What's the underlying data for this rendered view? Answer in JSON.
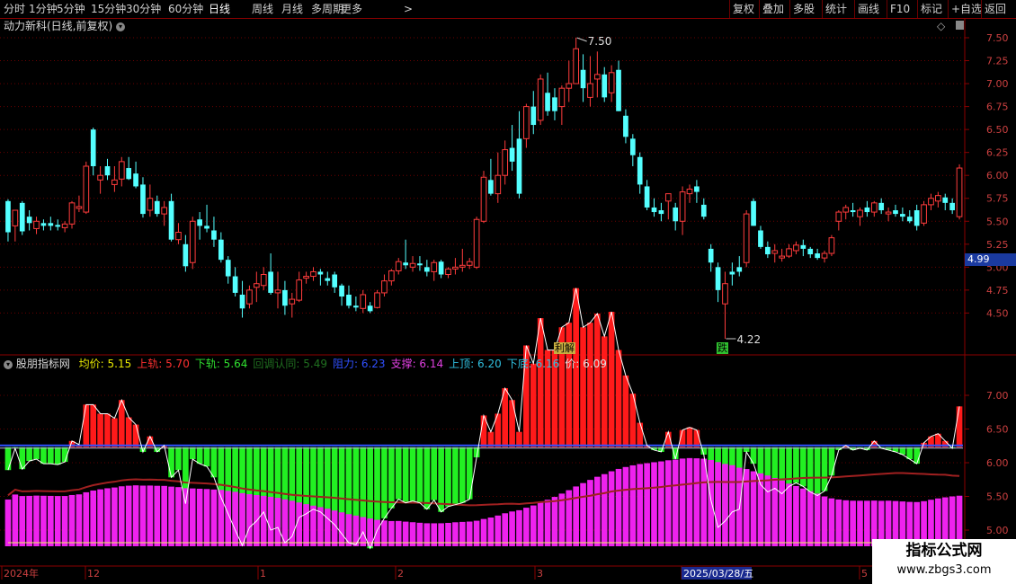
{
  "toolbar": {
    "periods": [
      "分时",
      "1分钟",
      "5分钟",
      "15分钟",
      "30分钟",
      "60分钟",
      "日线",
      "周线",
      "月线",
      "多周期",
      "更多"
    ],
    "active_period": "日线",
    "more_chevron": ">",
    "right_buttons": [
      "复权",
      "叠加",
      "多股",
      "统计",
      "画线",
      "F10",
      "标记",
      "+自选",
      "返回"
    ]
  },
  "main": {
    "title": "动力新科(日线,前复权)",
    "price_axis": [
      "7.50",
      "7.25",
      "7.00",
      "6.75",
      "6.50",
      "6.25",
      "6.00",
      "5.75",
      "5.50",
      "5.25",
      "5.00",
      "4.75",
      "4.50"
    ],
    "last_price_tag": "4.99",
    "high_label": "7.50",
    "low_label": "4.22",
    "markers": [
      "利解",
      "跌"
    ]
  },
  "sub": {
    "name": "股朋指标网",
    "indicators": [
      {
        "label": "均价:",
        "value": "5.15",
        "color": "#e8e800"
      },
      {
        "label": "上轨:",
        "value": "5.70",
        "color": "#ff3030"
      },
      {
        "label": "下轨:",
        "value": "5.64",
        "color": "#30e030"
      },
      {
        "label": "回调认同:",
        "value": "5.49",
        "color": "#207020"
      },
      {
        "label": "阻力:",
        "value": "6.23",
        "color": "#3050ff"
      },
      {
        "label": "支撑:",
        "value": "6.14",
        "color": "#e040e0"
      },
      {
        "label": "上顶:",
        "value": "6.20",
        "color": "#30c0e0"
      },
      {
        "label": "下底:",
        "value": "6.16",
        "color": "#30c0e0"
      },
      {
        "label": "价:",
        "value": "6.09",
        "color": "#e0e0e0"
      }
    ],
    "price_axis": [
      "7.00",
      "6.50",
      "6.00",
      "5.50",
      "5.00"
    ]
  },
  "date_axis": [
    "2024年",
    "12",
    "1",
    "2",
    "3",
    "2025/03/28/五",
    "5"
  ],
  "watermark": {
    "line1": "指标公式网",
    "line2": "www.zbgs3.com"
  },
  "chart_data": {
    "type": "candlestick",
    "title": "动力新科(日线,前复权)",
    "ylim": [
      4.22,
      7.5
    ],
    "series": [
      {
        "name": "K线 (开,高,低,收)",
        "values": [
          [
            5.72,
            5.74,
            5.28,
            5.38
          ],
          [
            5.45,
            5.62,
            5.28,
            5.62
          ],
          [
            5.7,
            5.72,
            5.35,
            5.39
          ],
          [
            5.55,
            5.62,
            5.4,
            5.48
          ],
          [
            5.42,
            5.55,
            5.36,
            5.5
          ],
          [
            5.48,
            5.52,
            5.4,
            5.45
          ],
          [
            5.48,
            5.55,
            5.4,
            5.45
          ],
          [
            5.46,
            5.52,
            5.4,
            5.44
          ],
          [
            5.43,
            5.5,
            5.38,
            5.47
          ],
          [
            5.47,
            5.72,
            5.42,
            5.7
          ],
          [
            5.64,
            5.78,
            5.6,
            5.66
          ],
          [
            5.6,
            6.15,
            5.58,
            6.1
          ],
          [
            6.5,
            6.52,
            6.0,
            6.1
          ],
          [
            5.95,
            6.1,
            5.8,
            6.0
          ],
          [
            6.1,
            6.18,
            5.95,
            6.0
          ],
          [
            5.9,
            6.1,
            5.82,
            5.95
          ],
          [
            5.96,
            6.2,
            5.88,
            6.15
          ],
          [
            6.08,
            6.2,
            5.95,
            5.96
          ],
          [
            6.02,
            6.15,
            5.86,
            5.88
          ],
          [
            5.9,
            5.98,
            5.54,
            5.58
          ],
          [
            5.62,
            5.9,
            5.55,
            5.75
          ],
          [
            5.72,
            5.78,
            5.55,
            5.58
          ],
          [
            5.58,
            5.72,
            5.45,
            5.65
          ],
          [
            5.72,
            5.8,
            5.28,
            5.3
          ],
          [
            5.3,
            5.48,
            5.25,
            5.38
          ],
          [
            5.25,
            5.35,
            4.95,
            5.01
          ],
          [
            5.05,
            5.55,
            4.98,
            5.5
          ],
          [
            5.52,
            5.6,
            5.3,
            5.45
          ],
          [
            5.45,
            5.68,
            5.38,
            5.42
          ],
          [
            5.4,
            5.55,
            5.22,
            5.3
          ],
          [
            5.3,
            5.38,
            5.05,
            5.08
          ],
          [
            5.08,
            5.12,
            4.82,
            4.9
          ],
          [
            4.9,
            5.0,
            4.68,
            4.72
          ],
          [
            4.7,
            4.85,
            4.45,
            4.55
          ],
          [
            4.6,
            4.8,
            4.55,
            4.75
          ],
          [
            4.78,
            4.95,
            4.62,
            4.82
          ],
          [
            4.8,
            5.0,
            4.75,
            4.92
          ],
          [
            4.95,
            5.15,
            4.7,
            4.72
          ],
          [
            4.72,
            4.95,
            4.55,
            4.75
          ],
          [
            4.75,
            4.85,
            4.48,
            4.58
          ],
          [
            4.6,
            4.72,
            4.45,
            4.65
          ],
          [
            4.64,
            4.95,
            4.62,
            4.86
          ],
          [
            4.88,
            4.95,
            4.82,
            4.9
          ],
          [
            4.9,
            5.0,
            4.85,
            4.95
          ],
          [
            4.95,
            4.98,
            4.8,
            4.92
          ],
          [
            4.88,
            4.95,
            4.8,
            4.85
          ],
          [
            4.92,
            4.95,
            4.72,
            4.78
          ],
          [
            4.8,
            4.82,
            4.58,
            4.68
          ],
          [
            4.7,
            4.8,
            4.55,
            4.58
          ],
          [
            4.58,
            4.68,
            4.52,
            4.56
          ],
          [
            4.55,
            4.75,
            4.5,
            4.7
          ],
          [
            4.58,
            4.62,
            4.5,
            4.52
          ],
          [
            4.56,
            4.75,
            4.55,
            4.72
          ],
          [
            4.72,
            4.92,
            4.68,
            4.85
          ],
          [
            4.85,
            4.98,
            4.8,
            4.96
          ],
          [
            4.96,
            5.1,
            4.92,
            5.06
          ],
          [
            5.05,
            5.3,
            4.98,
            5.02
          ],
          [
            5.0,
            5.12,
            4.95,
            5.04
          ],
          [
            5.04,
            5.12,
            4.96,
            5.02
          ],
          [
            5.0,
            5.08,
            4.9,
            4.95
          ],
          [
            4.95,
            5.08,
            4.85,
            5.05
          ],
          [
            5.06,
            5.08,
            4.88,
            4.92
          ],
          [
            4.92,
            5.0,
            4.88,
            4.98
          ],
          [
            4.98,
            5.1,
            4.92,
            5.0
          ],
          [
            5.0,
            5.2,
            4.95,
            5.02
          ],
          [
            5.02,
            5.1,
            4.98,
            5.06
          ],
          [
            5.0,
            5.55,
            4.98,
            5.52
          ],
          [
            5.5,
            6.05,
            5.48,
            5.98
          ],
          [
            5.95,
            6.18,
            5.78,
            5.8
          ],
          [
            5.8,
            6.25,
            5.7,
            6.0
          ],
          [
            6.0,
            6.38,
            5.9,
            6.28
          ],
          [
            6.3,
            6.55,
            6.05,
            6.15
          ],
          [
            6.4,
            6.7,
            5.75,
            5.8
          ],
          [
            6.4,
            6.78,
            6.3,
            6.75
          ],
          [
            6.75,
            6.92,
            6.45,
            6.55
          ],
          [
            6.6,
            7.1,
            6.55,
            7.05
          ],
          [
            6.9,
            7.12,
            6.65,
            6.7
          ],
          [
            6.85,
            6.95,
            6.6,
            6.7
          ],
          [
            6.75,
            6.98,
            6.55,
            6.95
          ],
          [
            6.95,
            7.25,
            6.8,
            7.0
          ],
          [
            7.0,
            7.5,
            7.0,
            7.38
          ],
          [
            7.15,
            7.32,
            6.8,
            6.95
          ],
          [
            6.85,
            7.3,
            6.75,
            7.0
          ],
          [
            7.05,
            7.35,
            6.85,
            7.1
          ],
          [
            7.1,
            7.18,
            6.8,
            6.85
          ],
          [
            6.9,
            7.2,
            6.8,
            7.12
          ],
          [
            7.15,
            7.25,
            6.7,
            6.7
          ],
          [
            6.65,
            6.72,
            6.35,
            6.42
          ],
          [
            6.4,
            6.45,
            6.1,
            6.22
          ],
          [
            6.2,
            6.25,
            5.8,
            5.9
          ],
          [
            5.88,
            5.95,
            5.62,
            5.65
          ],
          [
            5.65,
            5.75,
            5.55,
            5.6
          ],
          [
            5.62,
            5.7,
            5.5,
            5.58
          ],
          [
            5.72,
            5.78,
            5.52,
            5.8
          ],
          [
            5.65,
            5.7,
            5.4,
            5.5
          ],
          [
            5.5,
            5.88,
            5.35,
            5.82
          ],
          [
            5.8,
            5.9,
            5.7,
            5.85
          ],
          [
            5.88,
            5.95,
            5.7,
            5.82
          ],
          [
            5.68,
            5.75,
            5.52,
            5.55
          ],
          [
            5.2,
            5.25,
            4.95,
            5.05
          ],
          [
            5.0,
            5.05,
            4.62,
            4.75
          ],
          [
            4.6,
            4.95,
            4.22,
            4.82
          ],
          [
            4.95,
            5.05,
            4.8,
            4.92
          ],
          [
            5.0,
            5.12,
            4.9,
            4.95
          ],
          [
            5.05,
            5.62,
            5.0,
            5.58
          ],
          [
            5.72,
            5.75,
            5.45,
            5.45
          ],
          [
            5.4,
            5.45,
            5.2,
            5.22
          ],
          [
            5.22,
            5.28,
            5.1,
            5.14
          ],
          [
            5.15,
            5.25,
            5.05,
            5.18
          ],
          [
            5.1,
            5.2,
            5.06,
            5.12
          ],
          [
            5.12,
            5.25,
            5.1,
            5.2
          ],
          [
            5.18,
            5.28,
            5.14,
            5.24
          ],
          [
            5.24,
            5.3,
            5.12,
            5.2
          ],
          [
            5.2,
            5.22,
            5.1,
            5.14
          ],
          [
            5.15,
            5.2,
            5.08,
            5.1
          ],
          [
            5.1,
            5.18,
            5.05,
            5.15
          ],
          [
            5.15,
            5.35,
            5.12,
            5.32
          ],
          [
            5.5,
            5.62,
            5.4,
            5.6
          ],
          [
            5.6,
            5.68,
            5.52,
            5.65
          ],
          [
            5.62,
            5.7,
            5.55,
            5.6
          ],
          [
            5.55,
            5.65,
            5.45,
            5.62
          ],
          [
            5.65,
            5.72,
            5.55,
            5.6
          ],
          [
            5.6,
            5.72,
            5.55,
            5.7
          ],
          [
            5.7,
            5.75,
            5.58,
            5.62
          ],
          [
            5.58,
            5.65,
            5.5,
            5.6
          ],
          [
            5.62,
            5.68,
            5.55,
            5.58
          ],
          [
            5.58,
            5.65,
            5.5,
            5.55
          ],
          [
            5.55,
            5.62,
            5.48,
            5.5
          ],
          [
            5.62,
            5.68,
            5.4,
            5.45
          ],
          [
            5.48,
            5.72,
            5.45,
            5.68
          ],
          [
            5.68,
            5.8,
            5.62,
            5.75
          ],
          [
            5.72,
            5.82,
            5.65,
            5.78
          ],
          [
            5.76,
            5.8,
            5.62,
            5.7
          ],
          [
            5.7,
            5.75,
            5.58,
            5.62
          ],
          [
            5.55,
            6.12,
            5.52,
            6.08
          ]
        ]
      }
    ]
  }
}
